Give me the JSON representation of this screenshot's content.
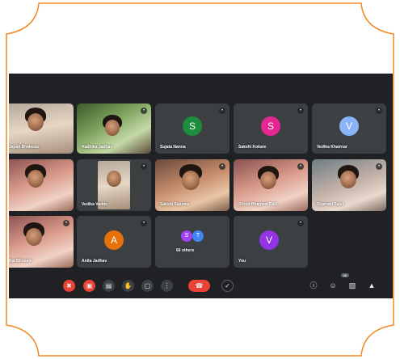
{
  "colors": {
    "frame": "#f08a24",
    "meeting_bg": "#202124",
    "tile_bg": "#3c4043",
    "avatar_s_green": "#1e8e3e",
    "avatar_s_pink": "#e52592",
    "avatar_v_gray": "#8ab4f8",
    "avatar_a_orange": "#e8710a",
    "avatar_v_purple": "#9334e6",
    "end_call": "#ea4335"
  },
  "participants": [
    {
      "name": "Jayati Bhalerao",
      "avatar": null
    },
    {
      "name": "Radhika Jadhav",
      "avatar": null
    },
    {
      "name": "Sujata Nanna",
      "avatar": "S"
    },
    {
      "name": "Sakshi Kokare",
      "avatar": "S"
    },
    {
      "name": "Vedika Khairnar",
      "avatar": "V"
    },
    {
      "name": "",
      "avatar": null
    },
    {
      "name": "Vedika Vadde",
      "avatar": null
    },
    {
      "name": "Sakshi Salunke",
      "avatar": null
    },
    {
      "name": "Shruti Bhagwat Patil",
      "avatar": null
    },
    {
      "name": "Sharvari Salvi",
      "avatar": null
    },
    {
      "name": "Rai Bhosale",
      "avatar": null
    },
    {
      "name": "Anita Jadhav",
      "avatar": "A"
    },
    {
      "name": "You",
      "avatar": "V"
    }
  ],
  "others": {
    "label": "66 others",
    "avatars": [
      "S",
      "T"
    ]
  },
  "controls": {
    "mic_icon": "mic-off-icon",
    "camera_icon": "camera-off-icon",
    "captions_icon": "captions-icon",
    "raise_hand_icon": "hand-icon",
    "present_icon": "present-icon",
    "more_icon": "more-vert-icon",
    "end_call_icon": "phone-hangup-icon",
    "right_icons": [
      "info-icon",
      "people-icon",
      "chat-icon",
      "activities-icon"
    ],
    "people_count": "66"
  }
}
